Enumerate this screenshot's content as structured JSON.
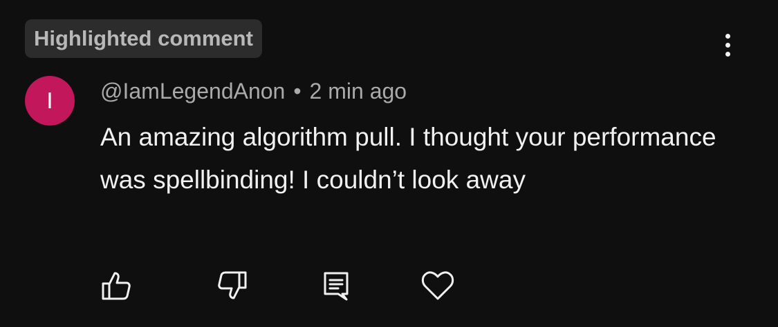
{
  "badge": {
    "label": "Highlighted comment"
  },
  "comment": {
    "avatar_initial": "I",
    "author": "@IamLegendAnon",
    "separator": "•",
    "time_ago": "2 min ago",
    "text": "An amazing algorithm pull. I thought your performance was spellbinding! I couldn’t look away"
  },
  "actions": {
    "like_icon": "thumbs-up-icon",
    "dislike_icon": "thumbs-down-icon",
    "reply_icon": "comment-icon",
    "heart_icon": "heart-icon",
    "more_icon": "more-vertical-icon"
  },
  "colors": {
    "background": "#0f0f0f",
    "badge_bg": "#2c2c2c",
    "avatar_bg": "#c2185b",
    "secondary_text": "#aaaaaa",
    "primary_text": "#f1f1f1"
  }
}
